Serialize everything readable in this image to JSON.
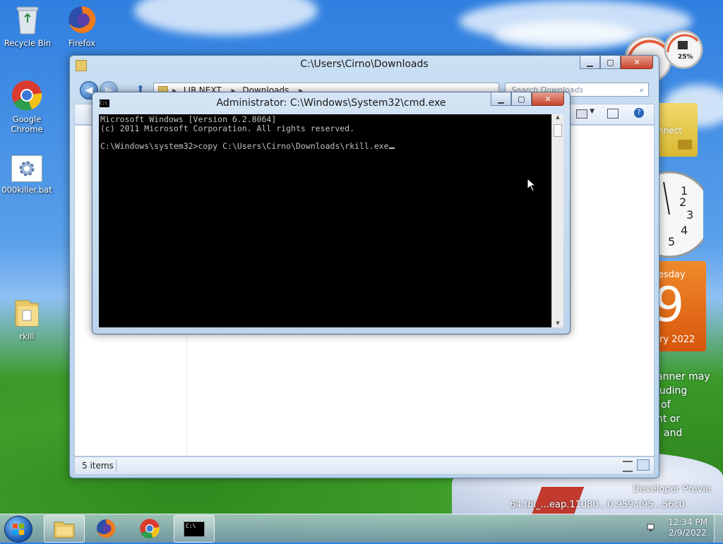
{
  "desktop": {
    "icons": [
      {
        "label": "Recycle Bin"
      },
      {
        "label": "Firefox"
      },
      {
        "label": "Google Chrome"
      },
      {
        "label": "000killer.bat"
      },
      {
        "label": "rkill"
      }
    ],
    "wallpaper_text": {
      "calendar_day_fragment": "esday",
      "calendar_date_fragment": "9",
      "calendar_month_fragment": "ry 2022",
      "partial_lines": [
        "anner may",
        "luding",
        "of",
        "nt or",
        "and"
      ],
      "watermark_line1": "Developer Previe",
      "watermark_line2": "64.fbl_...eap.11080...0.959cf95...56c0"
    },
    "cpu_meter_label": "25%"
  },
  "explorer": {
    "title": "C:\\Users\\Cirno\\Downloads",
    "address_parts": [
      "LIR.NEXT",
      "Downloads"
    ],
    "search_placeholder": "Search Downloads",
    "status_items": "5 items",
    "connect_fragment": "nnect"
  },
  "cmd": {
    "title": "Administrator: C:\\Windows\\System32\\cmd.exe",
    "line1": "Microsoft Windows [Version 6.2.8064]",
    "line2": "(c) 2011 Microsoft Corporation. All rights reserved.",
    "line3": "",
    "line4": "C:\\Windows\\system32>copy C:\\Users\\Cirno\\Downloads\\rkill.exe",
    "icon_text": "C:\\"
  },
  "taskbar": {
    "time": "12:34 PM",
    "date": "2/9/2022"
  },
  "colors": {
    "accent": "#3a78c8",
    "calendar_orange": "#e8630f",
    "console_bg": "#000000",
    "console_fg": "#c0c0c0"
  }
}
